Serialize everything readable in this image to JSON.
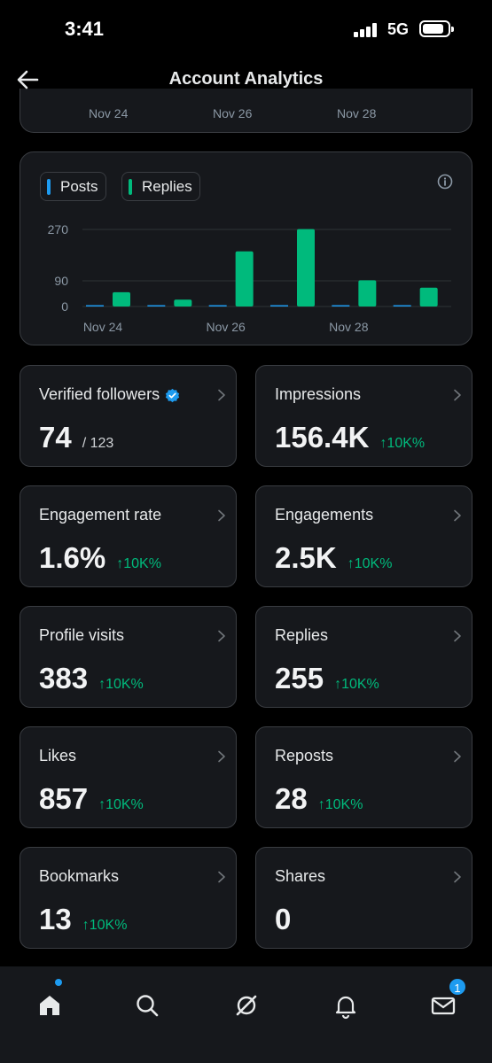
{
  "status": {
    "time": "3:41",
    "network": "5G"
  },
  "header": {
    "title": "Account Analytics"
  },
  "top_chart": {
    "x_ticks": [
      "Nov 24",
      "Nov 26",
      "Nov 28"
    ]
  },
  "chart": {
    "legend": [
      {
        "label": "Posts",
        "color": "#1d9bf0"
      },
      {
        "label": "Replies",
        "color": "#00ba7c"
      }
    ]
  },
  "chart_data": {
    "type": "bar",
    "categories": [
      "Nov 24",
      "Nov 25",
      "Nov 26",
      "Nov 27",
      "Nov 28",
      "Nov 29"
    ],
    "series": [
      {
        "name": "Posts",
        "values": [
          0,
          0,
          0,
          2,
          0,
          0
        ]
      },
      {
        "name": "Replies",
        "values": [
          50,
          24,
          193,
          271,
          92,
          66
        ]
      }
    ],
    "y_ticks": [
      0,
      90,
      270
    ],
    "x_tick_labels": [
      "Nov 24",
      "Nov 26",
      "Nov 28"
    ],
    "ylim": [
      0,
      270
    ],
    "grid": true,
    "legend_position": "top-left",
    "title": "",
    "xlabel": "",
    "ylabel": ""
  },
  "metrics": [
    {
      "label": "Verified followers",
      "value": "74",
      "sub": "/ 123",
      "change": "",
      "verified": true
    },
    {
      "label": "Impressions",
      "value": "156.4K",
      "sub": "",
      "change": "↑10K%"
    },
    {
      "label": "Engagement rate",
      "value": "1.6%",
      "sub": "",
      "change": "↑10K%"
    },
    {
      "label": "Engagements",
      "value": "2.5K",
      "sub": "",
      "change": "↑10K%"
    },
    {
      "label": "Profile visits",
      "value": "383",
      "sub": "",
      "change": "↑10K%"
    },
    {
      "label": "Replies",
      "value": "255",
      "sub": "",
      "change": "↑10K%"
    },
    {
      "label": "Likes",
      "value": "857",
      "sub": "",
      "change": "↑10K%"
    },
    {
      "label": "Reposts",
      "value": "28",
      "sub": "",
      "change": "↑10K%"
    },
    {
      "label": "Bookmarks",
      "value": "13",
      "sub": "",
      "change": "↑10K%"
    },
    {
      "label": "Shares",
      "value": "0",
      "sub": "",
      "change": ""
    }
  ],
  "tabbar": {
    "icons": [
      "home-icon",
      "search-icon",
      "grok-icon",
      "bell-icon",
      "mail-icon"
    ],
    "messages_badge": "1"
  },
  "colors": {
    "accent": "#1d9bf0",
    "positive": "#00ba7c",
    "card": "#16181c",
    "border": "#3a3d42"
  }
}
